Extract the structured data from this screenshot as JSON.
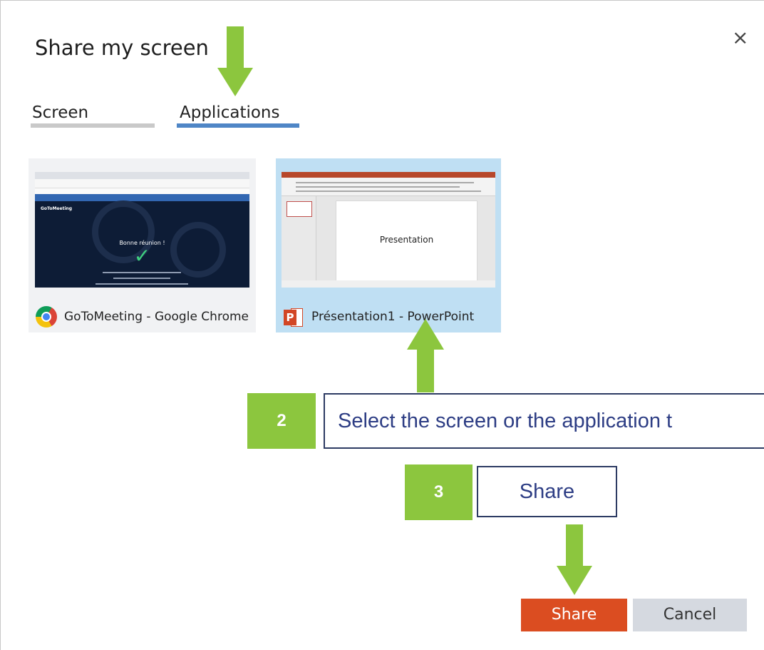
{
  "dialog": {
    "title": "Share my screen",
    "close_icon": "×"
  },
  "tabs": [
    {
      "label": "Screen",
      "selected": false
    },
    {
      "label": "Applications",
      "selected": true
    }
  ],
  "applications": [
    {
      "label": "GoToMeeting - Google Chrome",
      "icon": "chrome-icon",
      "selected": false,
      "thumbnail": {
        "greeting": "Bonne réunion !",
        "logo": "GoToMeeting"
      }
    },
    {
      "label": "Présentation1 - PowerPoint",
      "icon": "powerpoint-icon",
      "selected": true,
      "thumbnail": {
        "slide_text": "Presentation",
        "icon_letter": "P"
      }
    }
  ],
  "annotations": {
    "step2": {
      "number": "2",
      "text": "Select the screen or the application t"
    },
    "step3": {
      "number": "3",
      "text": "Share"
    }
  },
  "buttons": {
    "share": "Share",
    "cancel": "Cancel"
  },
  "colors": {
    "accent": "#4f86c6",
    "share_button": "#db4d21",
    "cancel_button": "#d5d9e0",
    "annotation_green": "#8cc63e",
    "selected_card": "#bfdff3"
  }
}
